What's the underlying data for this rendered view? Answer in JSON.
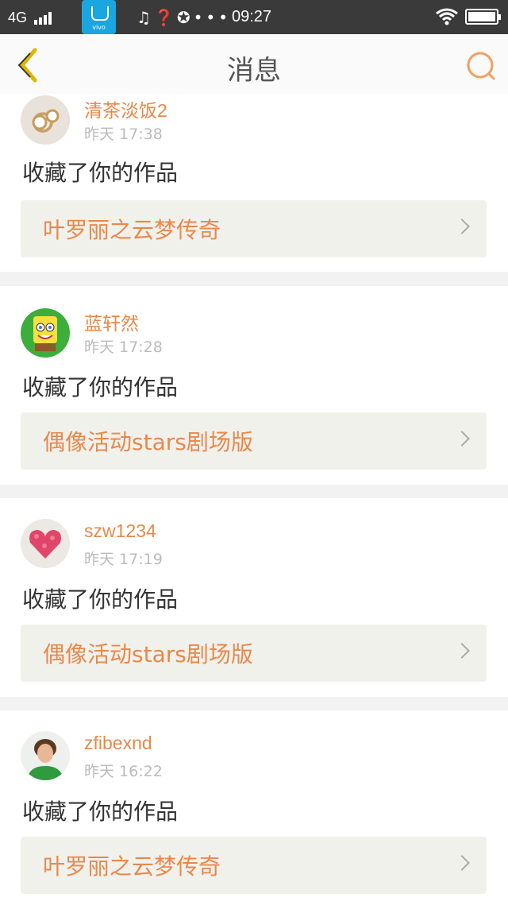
{
  "status_bar": {
    "network": "4G",
    "app_label": "vivo",
    "time": "09:27"
  },
  "header": {
    "title": "消息"
  },
  "messages": [
    {
      "username": "清茶淡饭2",
      "time": "昨天 17:38",
      "action": "收藏了你的作品",
      "work": "叶罗丽之云梦传奇",
      "avatar": "pearl-earring-avatar"
    },
    {
      "username": "蓝轩然",
      "time": "昨天 17:28",
      "action": "收藏了你的作品",
      "work": "偶像活动stars剧场版",
      "avatar": "spongebob-avatar"
    },
    {
      "username": "szw1234",
      "time": "昨天 17:19",
      "action": "收藏了你的作品",
      "work": "偶像活动stars剧场版",
      "avatar": "heart-flowers-avatar"
    },
    {
      "username": "zfibexnd",
      "time": "昨天 16:22",
      "action": "收藏了你的作品",
      "work": "叶罗丽之云梦传奇",
      "avatar": "boy-photo-avatar"
    }
  ],
  "colors": {
    "accent": "#e8884a",
    "back_icon": "#e0b400",
    "search_icon": "#f0a060"
  }
}
